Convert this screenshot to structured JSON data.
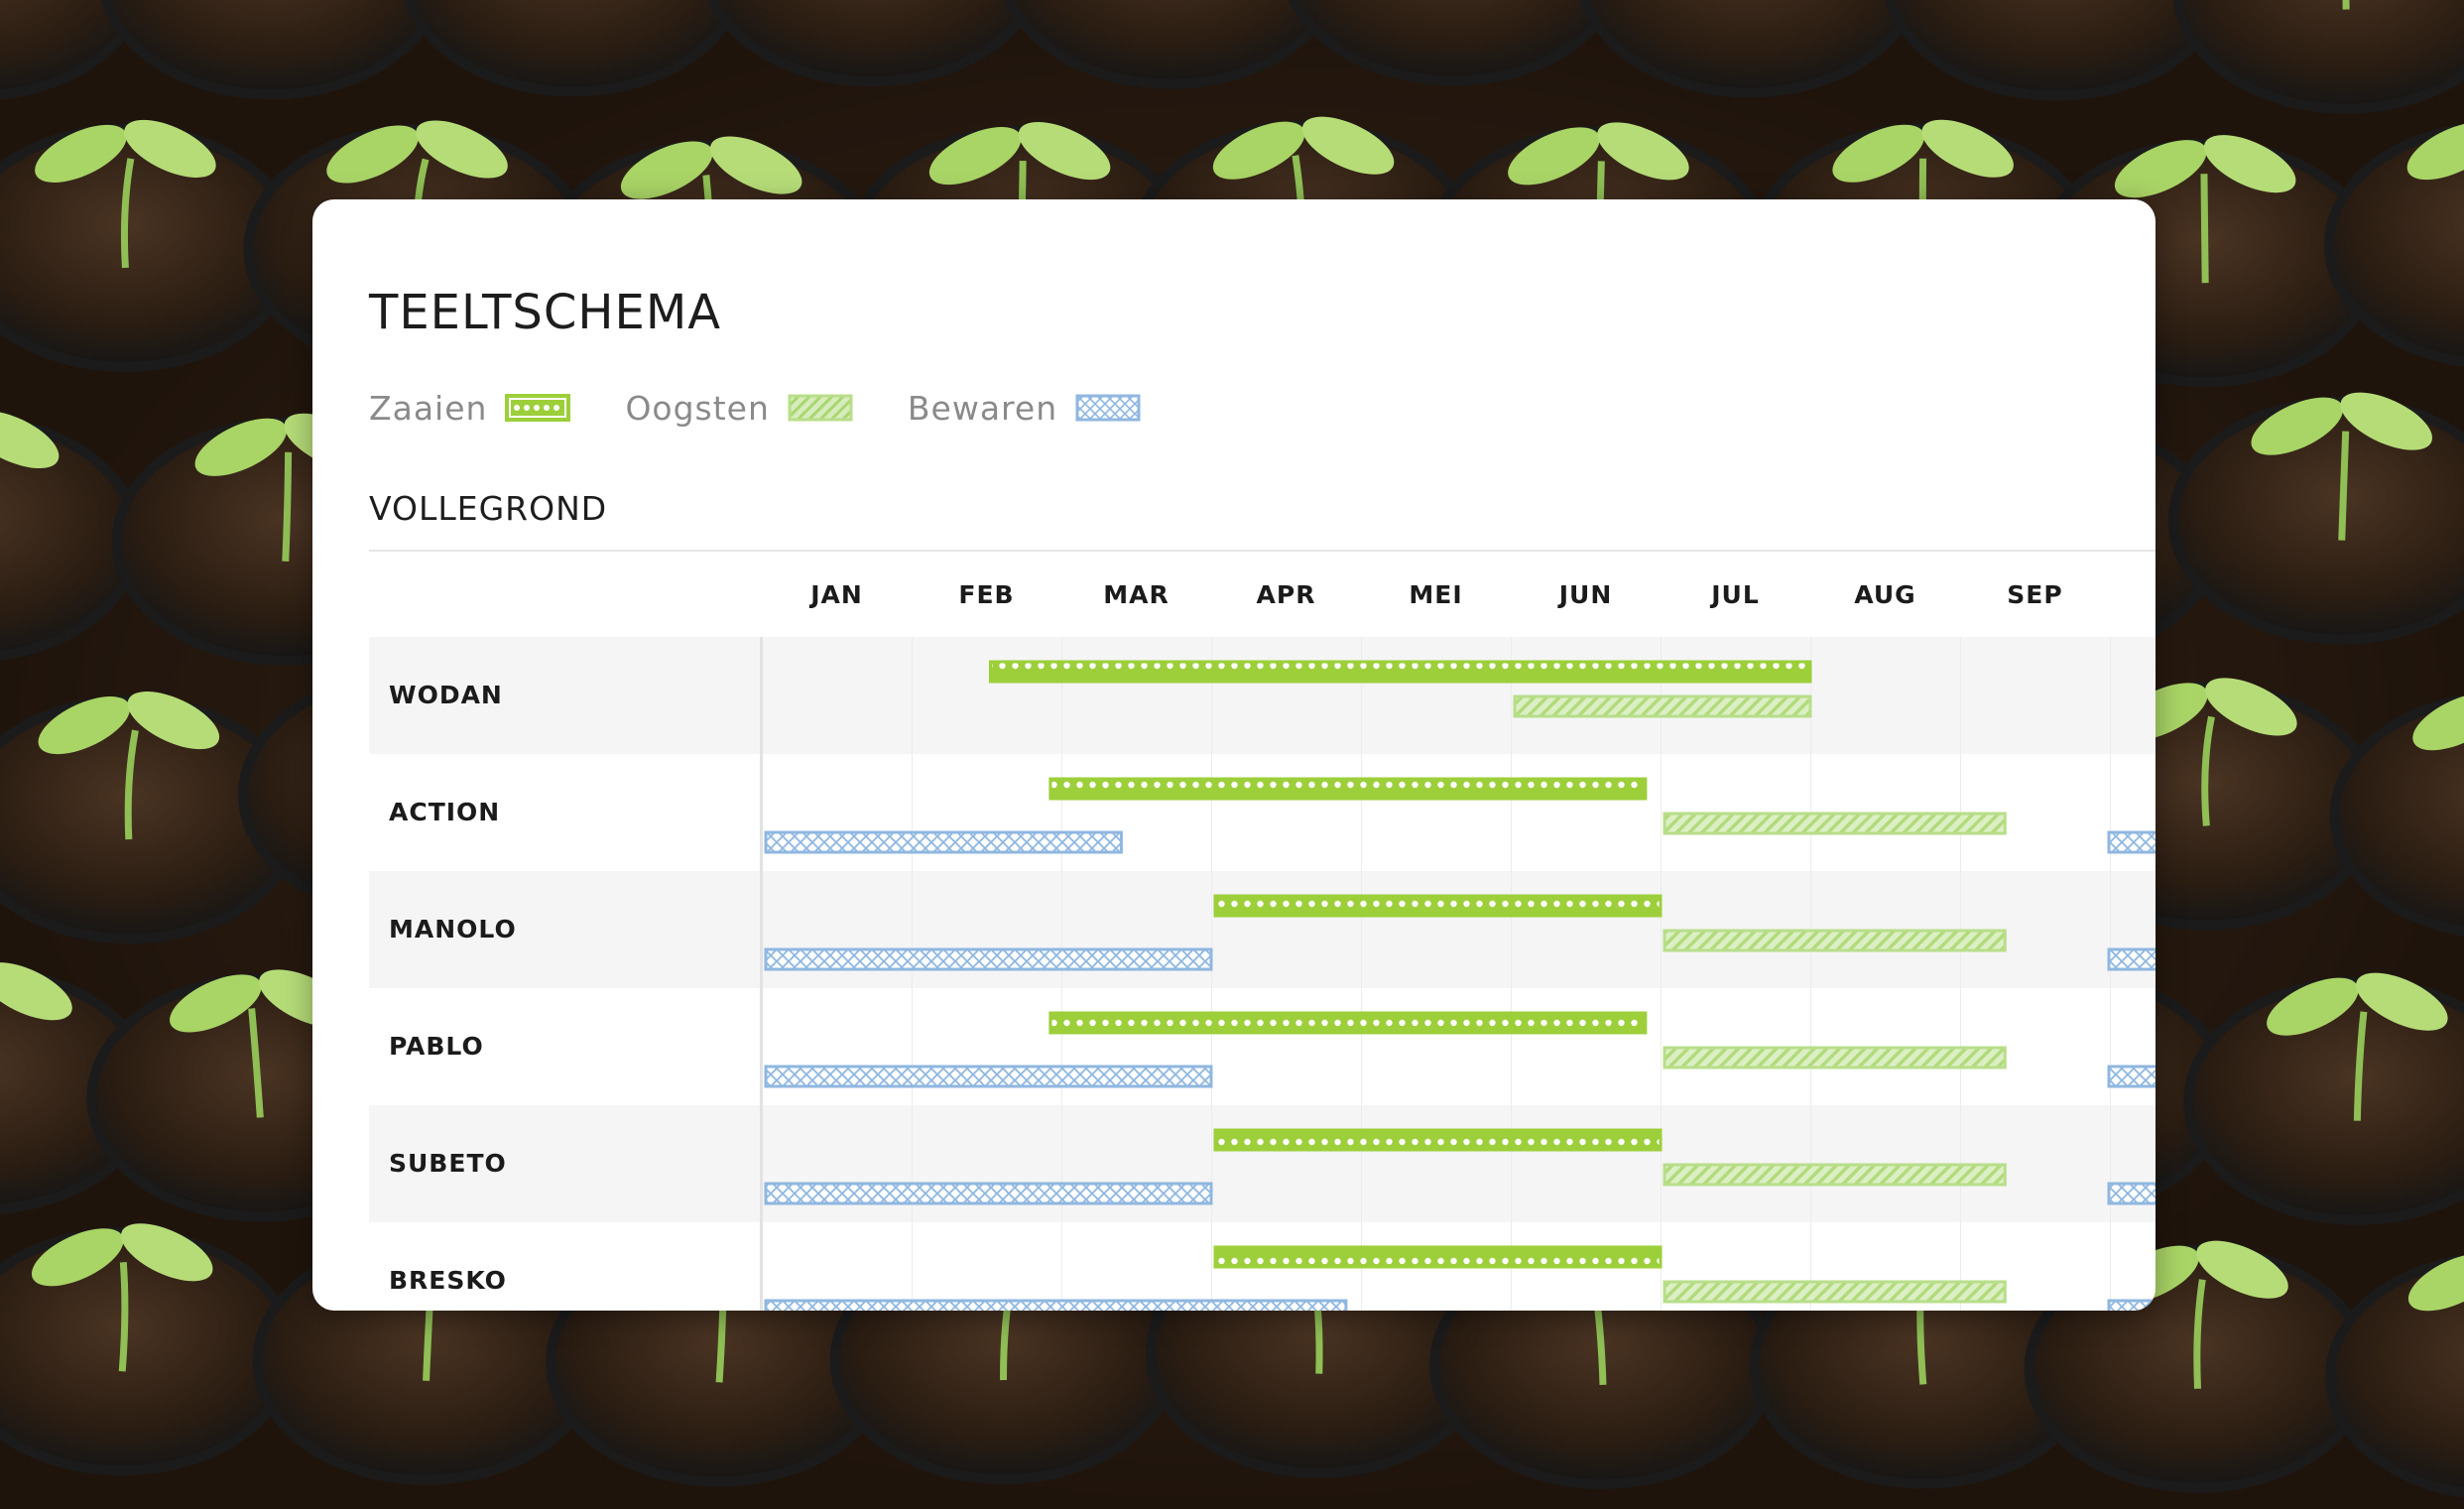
{
  "title": "TEELTSCHEMA",
  "legend": [
    {
      "label": "Zaaien",
      "kind": "zaaien"
    },
    {
      "label": "Oogsten",
      "kind": "oogsten"
    },
    {
      "label": "Bewaren",
      "kind": "bewaren"
    }
  ],
  "section_title": "VOLLEGROND",
  "colors": {
    "zaaien": "#9ccf3a",
    "oogsten": "#b8de8a",
    "bewaren": "#8fb7e0"
  },
  "months": [
    "JAN",
    "FEB",
    "MRT",
    "APR",
    "MEI",
    "JUN",
    "JUL",
    "AUG",
    "SEP"
  ],
  "months_display": [
    "JAN",
    "FEB",
    "MAR",
    "APR",
    "MEI",
    "JUN",
    "JUL",
    "AUG",
    "SEP"
  ],
  "varieties": [
    {
      "name": "WODAN",
      "zaaien": [
        2.5,
        8.0
      ],
      "oogsten": [
        6.0,
        8.0
      ],
      "bewaren": null
    },
    {
      "name": "ACTION",
      "zaaien": [
        2.9,
        6.9
      ],
      "oogsten": [
        7.0,
        9.3
      ],
      "bewaren": [
        1.0,
        3.4
      ]
    },
    {
      "name": "MANOLO",
      "zaaien": [
        4.0,
        7.0
      ],
      "oogsten": [
        7.0,
        9.3
      ],
      "bewaren": [
        1.0,
        4.0
      ]
    },
    {
      "name": "PABLO",
      "zaaien": [
        2.9,
        6.9
      ],
      "oogsten": [
        7.0,
        9.3
      ],
      "bewaren": [
        1.0,
        4.0
      ]
    },
    {
      "name": "SUBETO",
      "zaaien": [
        4.0,
        7.0
      ],
      "oogsten": [
        7.0,
        9.3
      ],
      "bewaren": [
        1.0,
        4.0
      ]
    },
    {
      "name": "BRESKO",
      "zaaien": [
        4.0,
        7.0
      ],
      "oogsten": [
        7.0,
        9.3
      ],
      "bewaren": [
        1.0,
        4.9
      ]
    }
  ]
}
